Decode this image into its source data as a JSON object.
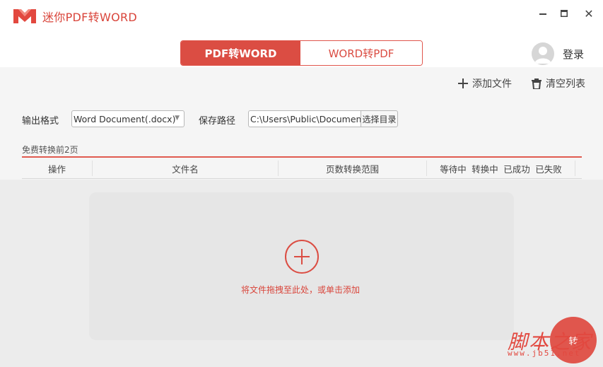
{
  "app": {
    "title": "迷你PDF转WORD"
  },
  "window": {
    "close_symbol": "✕"
  },
  "tabs": [
    {
      "label": "PDF转WORD",
      "active": true
    },
    {
      "label": "WORD转PDF",
      "active": false
    }
  ],
  "user": {
    "login_label": "登录"
  },
  "toolbar": {
    "add_file_label": "添加文件",
    "clear_list_label": "清空列表"
  },
  "settings": {
    "format_label": "输出格式",
    "format_value": "Word Document(.docx)",
    "path_label": "保存路径",
    "path_value": "C:\\Users\\Public\\Documents",
    "choose_dir_label": "选择目录"
  },
  "free_note": "免费转换前2页",
  "table": {
    "columns": [
      "操作",
      "文件名",
      "页数转换范围",
      "等待中",
      "转换中",
      "已成功",
      "已失败"
    ]
  },
  "drop_zone": {
    "hint": "将文件拖拽至此处，或单击添加"
  },
  "watermark": {
    "main": "脚本之家",
    "sub": "www.jb51.net"
  },
  "badge": {
    "label": "转"
  },
  "colors": {
    "accent": "#db4d43",
    "background": "#f5f5f5"
  },
  "icons": [
    "logo-m-icon",
    "minimize-icon",
    "maximize-icon",
    "close-icon",
    "user-avatar-icon",
    "plus-icon",
    "trash-icon",
    "dropdown-arrow-icon",
    "add-circle-icon"
  ]
}
